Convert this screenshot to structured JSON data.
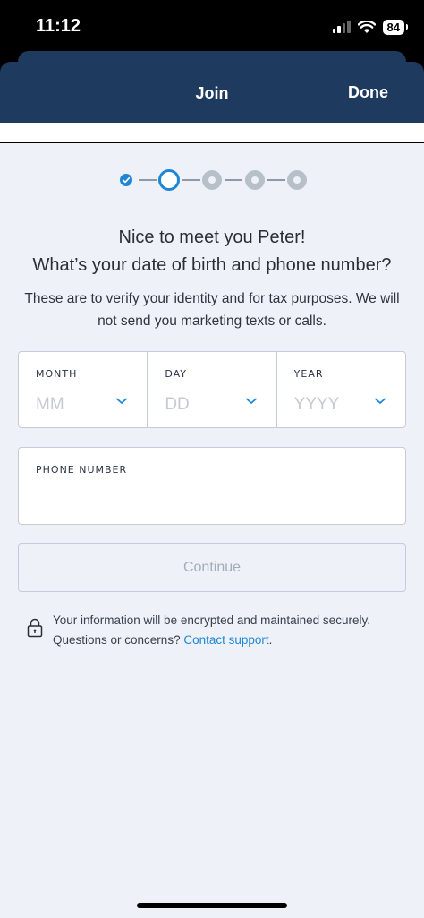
{
  "status_bar": {
    "time": "11:12",
    "battery": "84"
  },
  "header": {
    "title": "Join",
    "done_label": "Done"
  },
  "stepper": {
    "total_steps": 5,
    "current_step": 2,
    "accent_color": "#1f86d6"
  },
  "main": {
    "greeting": "Nice to meet you Peter!",
    "question": "What’s your date of birth and phone number?",
    "description": "These are to verify your identity and for tax purposes. We will not send you marketing texts or calls."
  },
  "dob": {
    "month_label": "MONTH",
    "month_placeholder": "MM",
    "day_label": "DAY",
    "day_placeholder": "DD",
    "year_label": "YEAR",
    "year_placeholder": "YYYY"
  },
  "phone": {
    "label": "PHONE NUMBER",
    "value": ""
  },
  "continue_label": "Continue",
  "security": {
    "text": "Your information will be encrypted and maintained securely. Questions or concerns?",
    "link_text": "Contact support",
    "trailing": "."
  },
  "colors": {
    "header_bg": "#1f3a5f",
    "page_bg": "#eef2f8",
    "link": "#1f86d6"
  }
}
